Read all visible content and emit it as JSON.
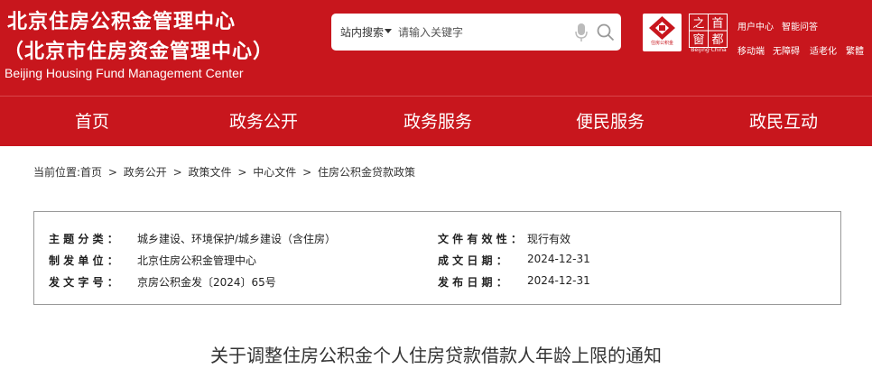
{
  "header": {
    "title_line1": "北京住房公积金管理中心",
    "title_line2": "（北京市住房资金管理中心）",
    "subtitle": "Beijing Housing Fund Management Center",
    "logo1_text": "住房公积金",
    "logo2_chars": [
      "之",
      "首",
      "窗",
      "都"
    ],
    "logo2_text": "Beijing·China",
    "links_row1": [
      "用户中心",
      "智能问答"
    ],
    "links_row2": [
      "移动端",
      "无障碍",
      "适老化",
      "繁體"
    ]
  },
  "search": {
    "scope": "站内搜索",
    "placeholder": "请输入关键字"
  },
  "nav": {
    "items": [
      "首页",
      "政务公开",
      "政务服务",
      "便民服务",
      "政民互动"
    ]
  },
  "breadcrumb": {
    "prefix": "当前位置:",
    "items": [
      "首页",
      "政务公开",
      "政策文件",
      "中心文件",
      "住房公积金贷款政策"
    ],
    "separator": ">"
  },
  "info": {
    "category_label": "主 题 分 类 ：",
    "category_value": "城乡建设、环境保护/城乡建设（含住房）",
    "issuer_label": "制 发 单 位 ：",
    "issuer_value": "北京住房公积金管理中心",
    "docno_label": "发 文 字 号 ：",
    "docno_value": "京房公积金发〔2024〕65号",
    "validity_label": "文 件 有 效 性 ：",
    "validity_value": "现行有效",
    "written_label": "成 文 日 期 ：",
    "written_value": "2024-12-31",
    "published_label": "发 布 日 期 ：",
    "published_value": "2024-12-31"
  },
  "document": {
    "title": "关于调整住房公积金个人住房贷款借款人年龄上限的通知"
  },
  "colors": {
    "brand_red": "#c8161d",
    "text": "#333333"
  }
}
